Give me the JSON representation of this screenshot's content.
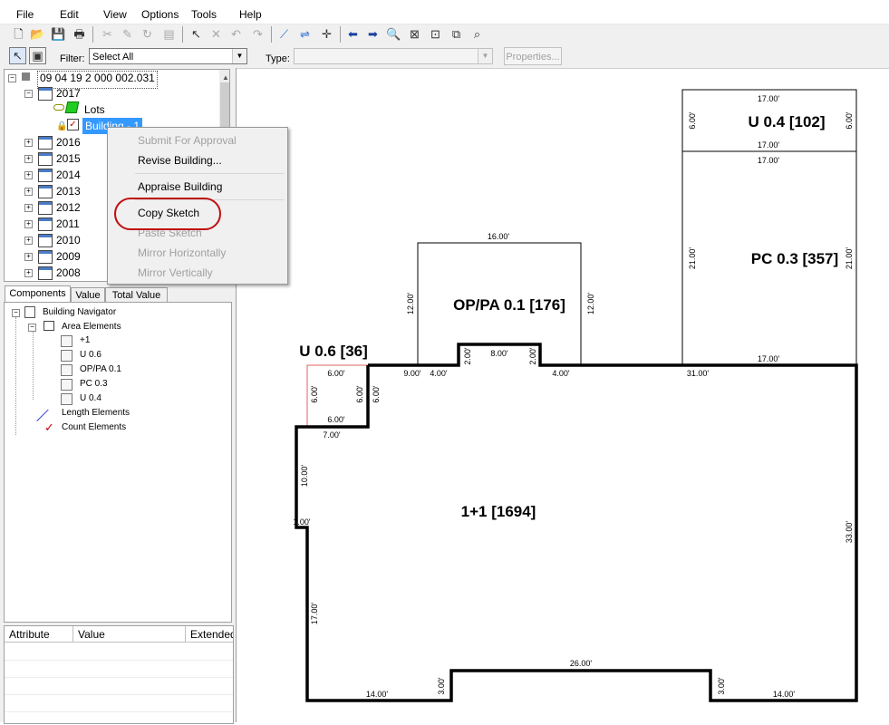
{
  "menubar": {
    "items": [
      "File",
      "Edit",
      "View",
      "Options",
      "Tools",
      "Help"
    ]
  },
  "filterbar": {
    "filter_label": "Filter:",
    "filter_value": "Select All",
    "type_label": "Type:",
    "type_value": "",
    "properties_label": "Properties..."
  },
  "tree": {
    "root": "09 04 19 2 000 002.031",
    "year_open": "2017",
    "lots": "Lots",
    "building": "Building - 1",
    "years": [
      "2016",
      "2015",
      "2014",
      "2013",
      "2012",
      "2011",
      "2010",
      "2009",
      "2008"
    ]
  },
  "context_menu": {
    "items": [
      {
        "label": "Submit For Approval",
        "enabled": false
      },
      {
        "label": "Revise Building...",
        "enabled": true
      },
      {
        "label": "Appraise Building",
        "enabled": true
      },
      {
        "label": "Copy Sketch",
        "enabled": true
      },
      {
        "label": "Paste Sketch",
        "enabled": false
      },
      {
        "label": "Mirror Horizontally",
        "enabled": false
      },
      {
        "label": "Mirror Vertically",
        "enabled": false
      }
    ]
  },
  "tabs": [
    "Components",
    "Value",
    "Total Value"
  ],
  "navigator": {
    "root": "Building Navigator",
    "area_elements": "Area Elements",
    "areas": [
      "+1",
      "U 0.6",
      "OP/PA 0.1",
      "PC 0.3",
      "U 0.4"
    ],
    "length_elements": "Length Elements",
    "count_elements": "Count Elements"
  },
  "attr_grid": {
    "columns": [
      "Attribute",
      "Value",
      "Extended"
    ]
  },
  "sketch": {
    "areas": {
      "u04": "U 0.4 [102]",
      "pc03": "PC 0.3 [357]",
      "oppa": "OP/PA 0.1 [176]",
      "u06": "U 0.6 [36]",
      "main": "1+1 [1694]"
    },
    "dims": {
      "u04_top": "17.00'",
      "u04_left": "6.00'",
      "u04_right": "6.00'",
      "u04_bottom": "17.00'",
      "pc_top": "17.00'",
      "pc_left": "21.00'",
      "pc_right": "21.00'",
      "pc_bottom": "17.00'",
      "op_top": "16.00'",
      "op_left": "12.00'",
      "op_right": "12.00'",
      "step_l": "2.00'",
      "step_top": "8.00'",
      "step_r": "2.00'",
      "seg_900": "9.00'",
      "seg_400a": "4.00'",
      "seg_400b": "4.00'",
      "seg_3100": "31.00'",
      "u06_top": "6.00'",
      "u06_left": "6.00'",
      "u06_right": "6.00'",
      "u06_bottom": "6.00'",
      "u06_outer": "6.00'",
      "seg_700": "7.00'",
      "seg_1000": "10.00'",
      "seg_cut": "1.00'",
      "seg_1700": "17.00'",
      "seg_3300": "33.00'",
      "seg_2600": "26.00'",
      "seg_300a": "3.00'",
      "seg_300b": "3.00'",
      "seg_1400a": "14.00'",
      "seg_1400b": "14.00'"
    }
  },
  "colors": {
    "selection": "#3399ff",
    "highlight_ring": "#c01010",
    "u06_outline": "#e06060"
  }
}
